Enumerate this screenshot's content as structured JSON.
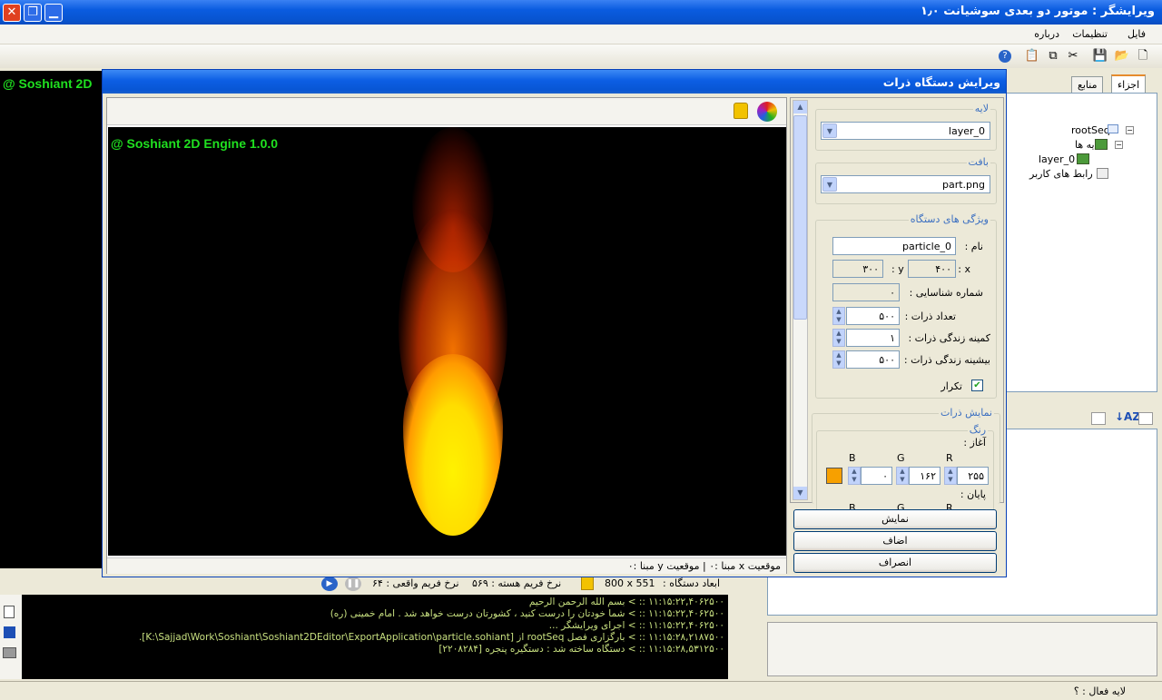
{
  "window": {
    "title": "ویرایشگر : موتور دو بعدی سوشیانت ۱٫۰"
  },
  "menu": {
    "file": "فایل",
    "settings": "تنظیمات",
    "about": "درباره"
  },
  "engine_banner": "@ Soshiant 2D Engine 1.0.0",
  "engine_banner_cut": "@ Soshiant 2D",
  "right_panel": {
    "tabs": {
      "components": "اجزاء",
      "resources": "منابع"
    },
    "tree": {
      "root": "rootSeq",
      "layers": "لایه ها",
      "layer0": "layer_0",
      "ui": "رابط های کاربر"
    }
  },
  "main_status": {
    "device_size_label": "ابعاد دستگاه :",
    "device_size": "800 x 551",
    "core_fps_label": "نرخ فریم هسته :",
    "core_fps": "۵۶۹",
    "real_fps_label": "نرخ فریم واقعی :",
    "real_fps": "۶۴"
  },
  "console": [
    "۱۱:۱۵:۲۲,۴۰۶۲۵۰۰ :: > بسم الله الرحمن الرحیم",
    "۱۱:۱۵:۲۲,۴۰۶۲۵۰۰ :: > شما خودتان را درست کنید ، کشورتان درست خواهد شد . امام خمینی (ره)",
    "۱۱:۱۵:۲۲,۴۰۶۲۵۰۰ :: > اجرای ویرایشگر ...",
    "۱۱:۱۵:۲۸,۲۱۸۷۵۰۰ :: > بارگزاری فصل rootSeq از [K:\\Sajjad\\Work\\Soshiant\\Soshiant2DEditor\\ExportApplication\\particle.sohiant].",
    "۱۱:۱۵:۲۸,۵۳۱۲۵۰۰ :: > دستگاه ساخته شد : دستگیره پنجره [۲۲۰۸۲۸۴]"
  ],
  "statusbar": {
    "active_layer": "لایه فعال : ؟"
  },
  "dialog": {
    "title": "ویرایش دستگاه ذرات",
    "preview_status": "موقعیت x مبنا :۰ | موقعیت y مبنا :۰",
    "layer_group": "لایه",
    "layer_value": "layer_0",
    "texture_group": "بافت",
    "texture_value": "part.png",
    "props_group": "ویژگی های دستگاه",
    "name_label": "نام :",
    "name_value": "particle_0",
    "x_label": "x :",
    "x_value": "۴۰۰",
    "y_label": "y :",
    "y_value": "۳۰۰",
    "id_label": "شماره شناسایی :",
    "id_value": "۰",
    "count_label": "تعداد ذرات :",
    "count_value": "۵۰۰",
    "minlife_label": "کمینه زندگی ذرات :",
    "minlife_value": "۱",
    "maxlife_label": "بیشینه زندگی ذرات :",
    "maxlife_value": "۵۰۰",
    "repeat_label": "تکرار",
    "display_group": "نمایش ذرات",
    "color_group": "رنگ",
    "start_label": "آغاز :",
    "end_label": "پایان :",
    "r_label": "R",
    "g_label": "G",
    "b_label": "B",
    "r_value": "۲۵۵",
    "g_value": "۱۶۲",
    "b_value": "۰",
    "swatch_color": "#f7a000",
    "btn_show": "نمایش",
    "btn_add": "اضاف",
    "btn_cancel": "انصراف"
  }
}
